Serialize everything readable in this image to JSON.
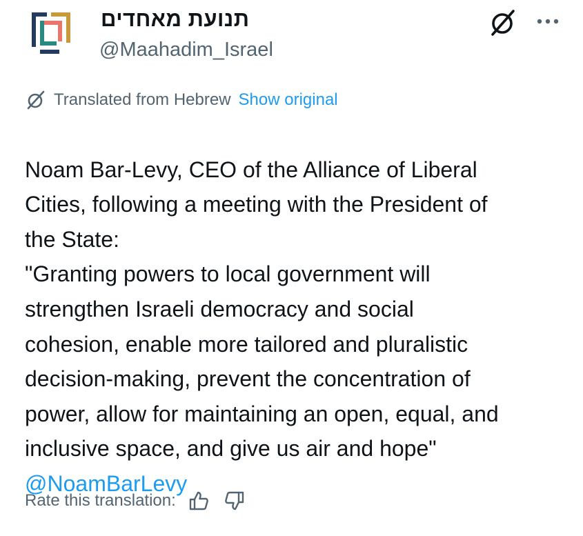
{
  "author": {
    "display_name": "תנועת מאחדים",
    "handle": "@Maahadim_Israel",
    "avatar": "maahadim-logo"
  },
  "header_actions": {
    "grok_icon": "grok-icon",
    "more_icon": "more-dots-icon"
  },
  "translation": {
    "note": "Translated from Hebrew",
    "show_original": "Show original",
    "icon": "grok-icon"
  },
  "tweet": {
    "text": "Noam Bar-Levy, CEO of the Alliance of Liberal\nCities, following a meeting with the President of\nthe State:\n\"Granting powers to local government will\nstrengthen Israeli democracy and social\ncohesion, enable more tailored and pluralistic\ndecision-making, prevent the concentration of\npower, allow for maintaining an open, equal, and\ninclusive space, and give us air and hope\"",
    "mention": "@NoamBarLevy"
  },
  "rating": {
    "label": "Rate this translation:",
    "thumbs_up_icon": "thumbs-up-icon",
    "thumbs_down_icon": "thumbs-down-icon"
  },
  "colors": {
    "text": "#0f1419",
    "secondary": "#536471",
    "link": "#1d9bf0",
    "logo_teal": "#2a8a82",
    "logo_salmon": "#e8766a",
    "logo_gold": "#c99a3c",
    "logo_navy": "#243a5e"
  }
}
